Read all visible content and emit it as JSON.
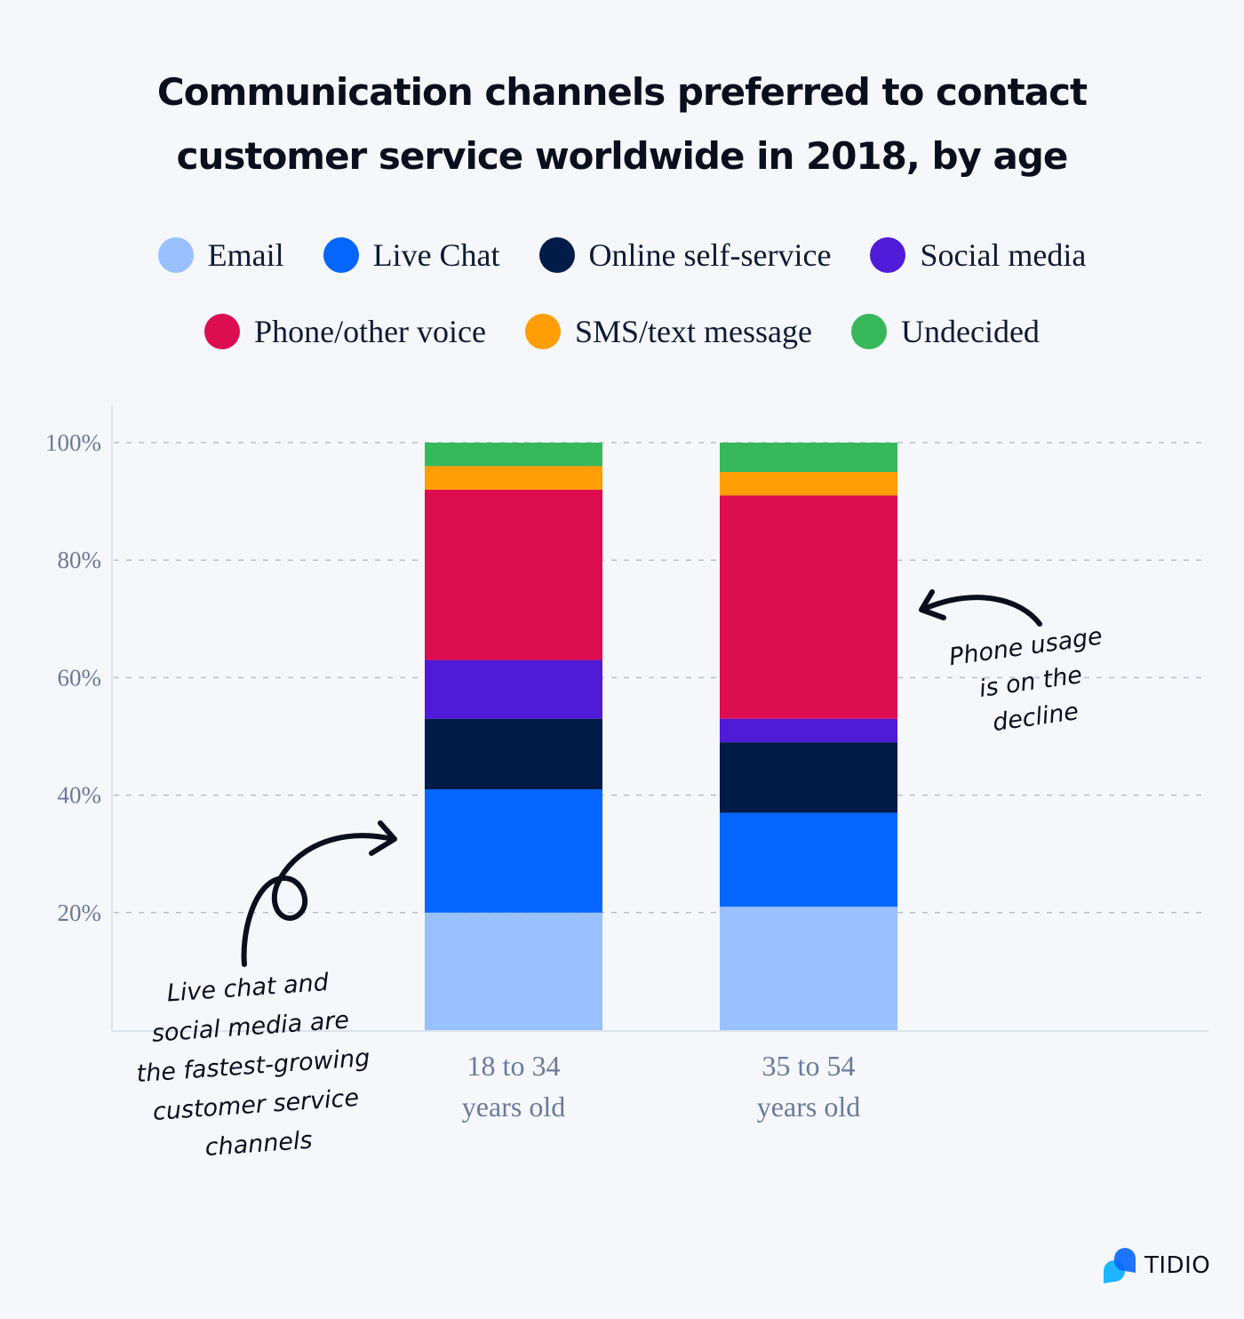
{
  "chart_data": {
    "type": "bar",
    "stacked": true,
    "title": "Communication channels preferred to contact customer service worldwide in 2018, by age",
    "title_lines": [
      "Communication channels preferred to contact",
      "customer service worldwide in 2018, by age"
    ],
    "categories": [
      "18 to 34 years old",
      "35 to 54 years old"
    ],
    "category_lines": [
      [
        "18 to 34",
        "years old"
      ],
      [
        "35 to 54",
        "years old"
      ]
    ],
    "series": [
      {
        "name": "Email",
        "color": "#99c0ff",
        "values": [
          20,
          21
        ]
      },
      {
        "name": "Live Chat",
        "color": "#0566ff",
        "values": [
          21,
          16
        ]
      },
      {
        "name": "Online self-service",
        "color": "#001b47",
        "values": [
          12,
          12
        ]
      },
      {
        "name": "Social media",
        "color": "#501bd6",
        "values": [
          10,
          4
        ]
      },
      {
        "name": "Phone/other voice",
        "color": "#dc0d50",
        "values": [
          29,
          38
        ]
      },
      {
        "name": "SMS/text message",
        "color": "#ff9e05",
        "values": [
          4,
          4
        ]
      },
      {
        "name": "Undecided",
        "color": "#36b85b",
        "values": [
          4,
          5
        ]
      }
    ],
    "xlabel": "",
    "ylabel": "",
    "ylim": [
      0,
      100
    ],
    "yticks": [
      20,
      40,
      60,
      80,
      100
    ],
    "ytick_labels": [
      "20%",
      "40%",
      "60%",
      "80%",
      "100%"
    ],
    "grid": true,
    "legend_placement": "top",
    "legend_rows": [
      [
        0,
        1,
        2,
        3
      ],
      [
        4,
        5,
        6
      ]
    ],
    "annotations": [
      {
        "id": "live-chat-note",
        "lines": [
          "Live chat and",
          "social media are",
          "the fastest-growing",
          "customer service",
          "channels"
        ]
      },
      {
        "id": "phone-note",
        "lines": [
          "Phone usage",
          "is on the",
          "decline"
        ]
      }
    ]
  },
  "brand": {
    "name": "TIDIO",
    "colors": [
      "#1fb5ff",
      "#0566ff"
    ]
  }
}
